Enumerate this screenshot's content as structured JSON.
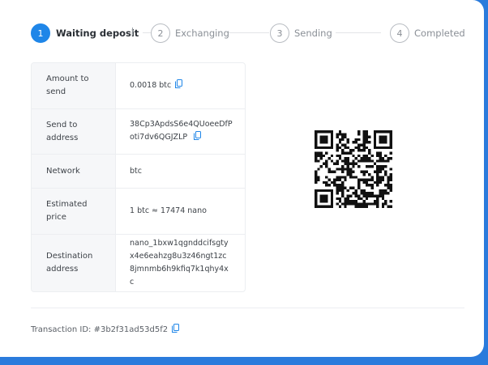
{
  "stepper": {
    "steps": [
      {
        "num": "1",
        "label": "Waiting deposit",
        "active": true
      },
      {
        "num": "2",
        "label": "Exchanging",
        "active": false
      },
      {
        "num": "3",
        "label": "Sending",
        "active": false
      },
      {
        "num": "4",
        "label": "Completed",
        "active": false
      }
    ]
  },
  "details": {
    "amount_label": "Amount to send",
    "amount_value": "0.0018 btc",
    "send_label": "Send to address",
    "send_value": "38Cp3ApdsS6e4QUoeeDfPoti7dv6QGJZLP",
    "network_label": "Network",
    "network_value": "btc",
    "price_label": "Estimated price",
    "price_value": "1 btc ≈ 17474 nano",
    "dest_label": "Destination address",
    "dest_value": "nano_1bxw1qgnddcifsgtyx4e6eahzg8u3z46ngt1zc8jmnmb6h9kfiq7k1qhy4xc"
  },
  "transaction": {
    "id_label": "Transaction ID: #3b2f31ad53d5f2"
  },
  "icons": {
    "copy": "copy-icon",
    "qr": "qr-code"
  },
  "colors": {
    "accent": "#1f86e8",
    "background": "#2a7bdc"
  }
}
